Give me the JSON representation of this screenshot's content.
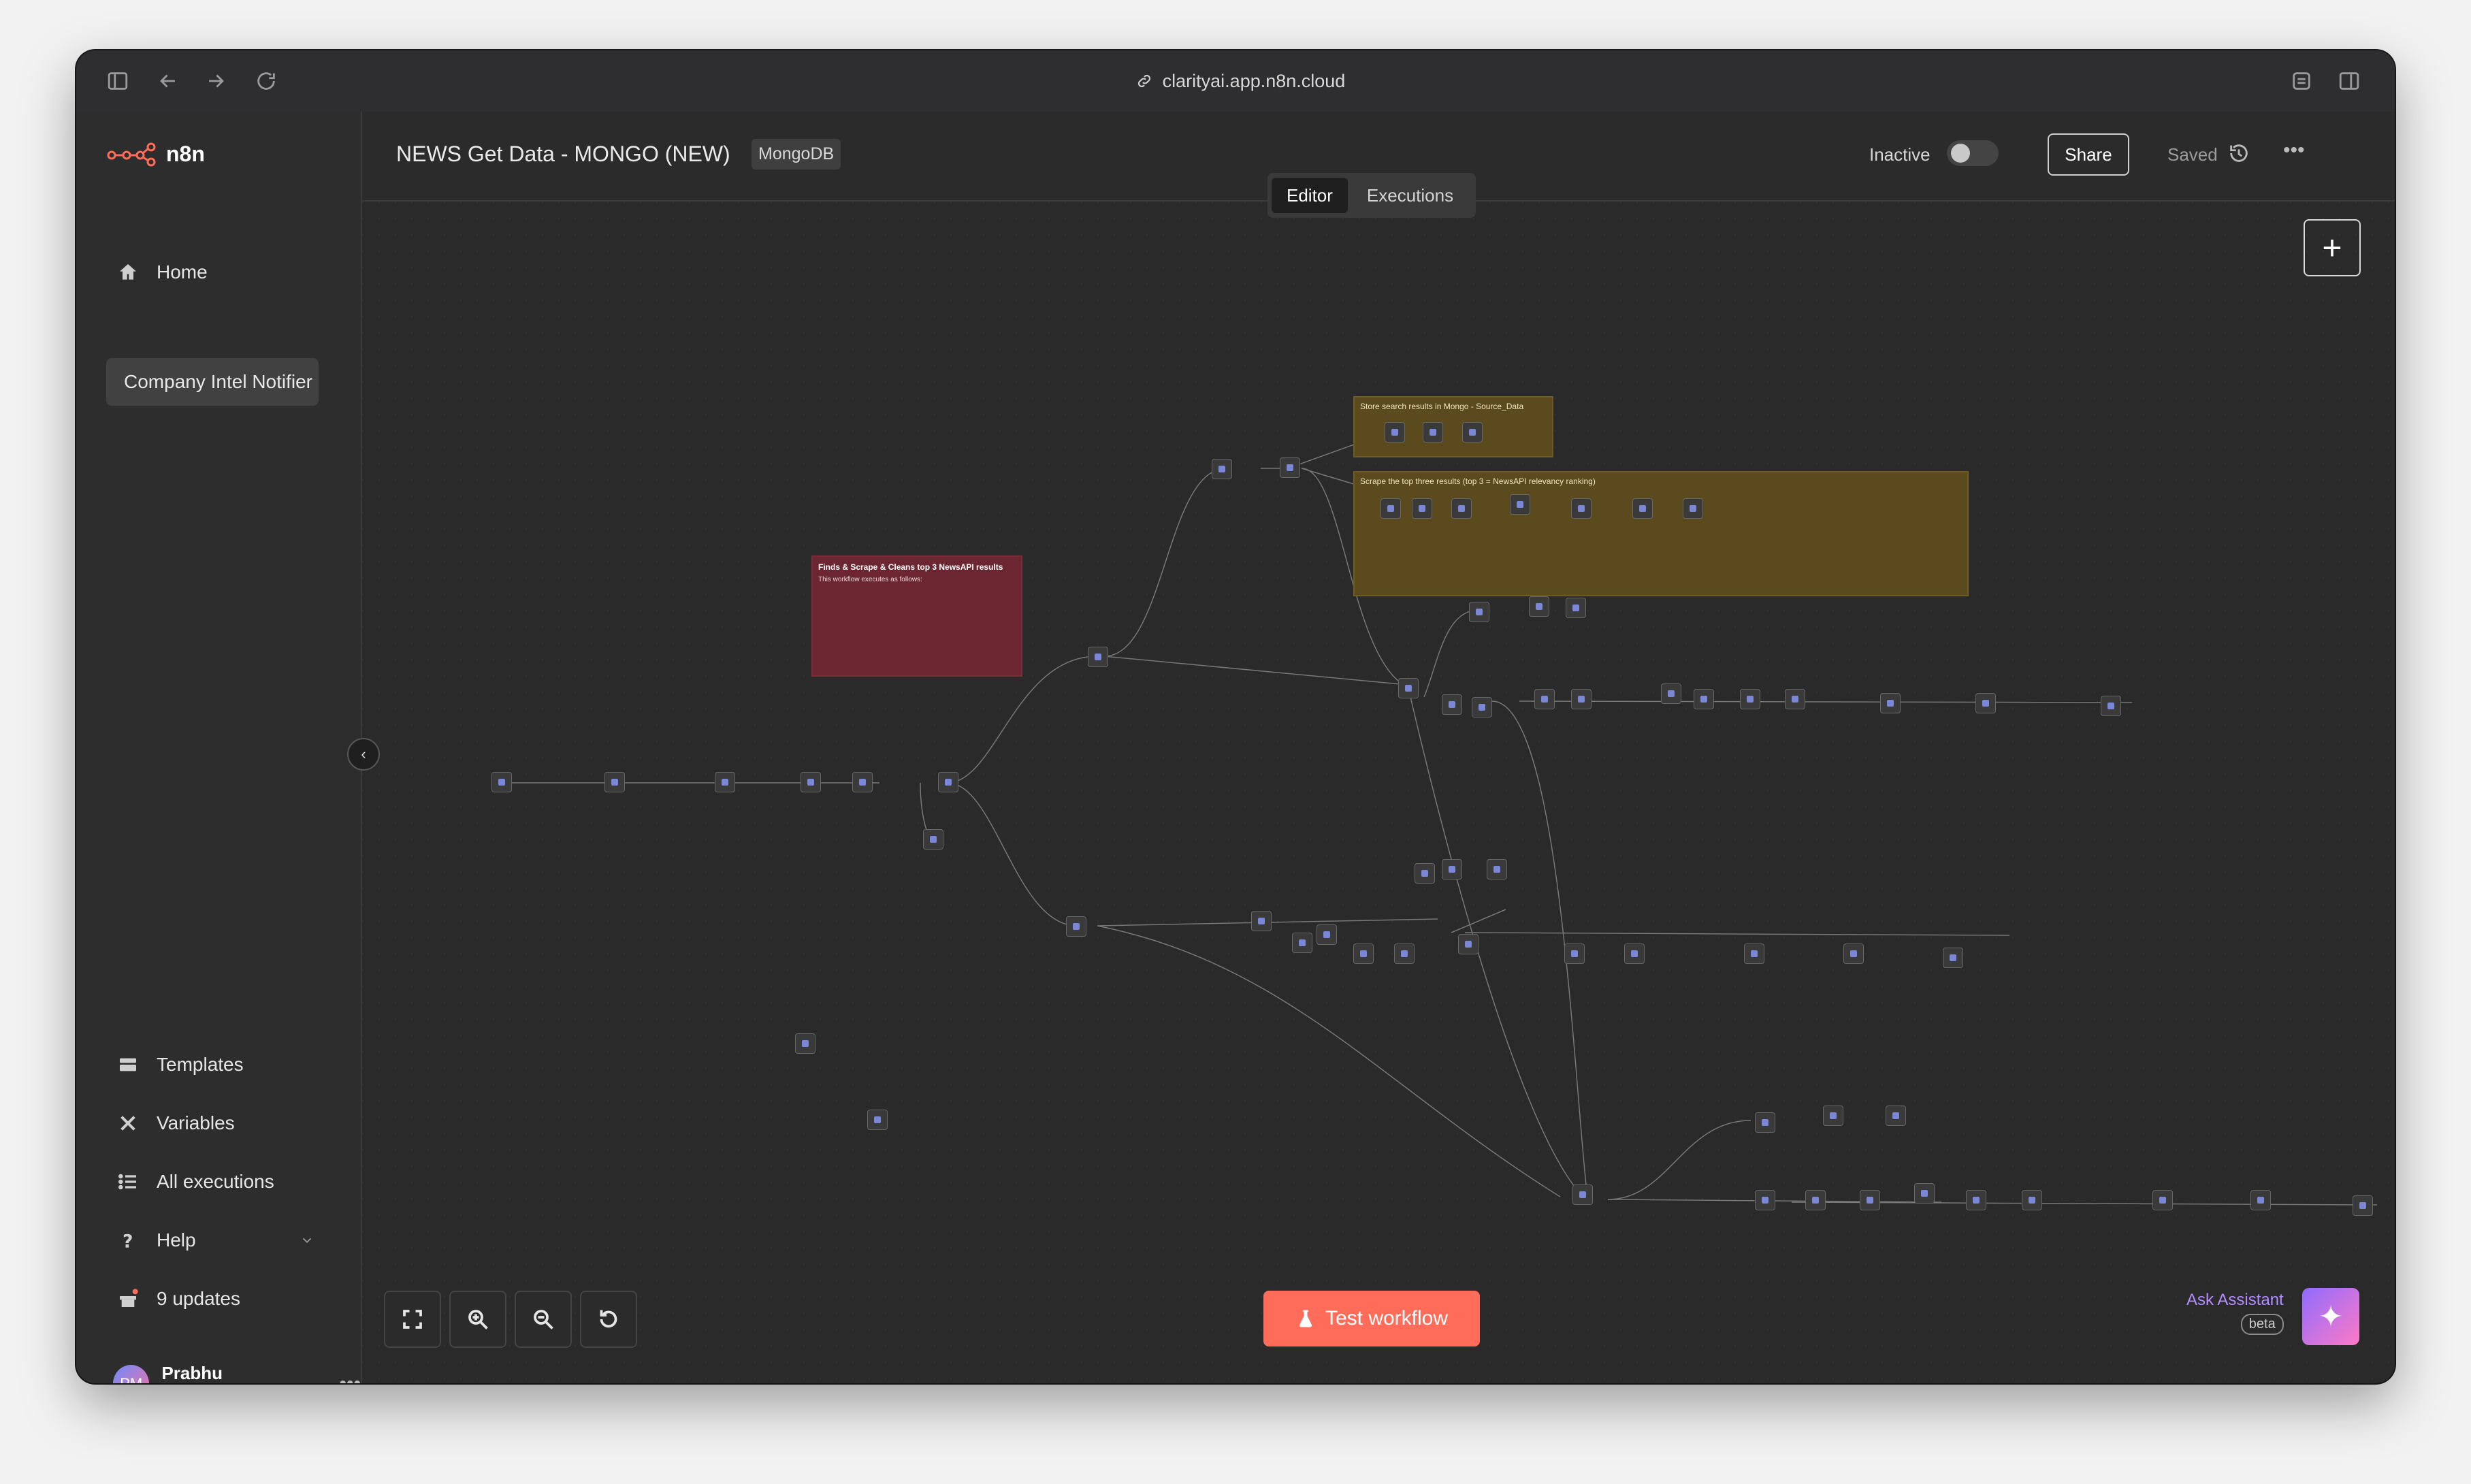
{
  "browser": {
    "url": "clarityai.app.n8n.cloud"
  },
  "sidebar": {
    "logo_text": "n8n",
    "home_label": "Home",
    "project_label": "Company Intel Notifier",
    "bottom_items": [
      {
        "label": "Templates",
        "icon": "templates-icon"
      },
      {
        "label": "Variables",
        "icon": "variables-icon"
      },
      {
        "label": "All executions",
        "icon": "executions-icon"
      },
      {
        "label": "Help",
        "icon": "help-icon"
      },
      {
        "label": "9 updates",
        "icon": "gift-icon"
      }
    ],
    "user": {
      "initials": "PM",
      "name": "Prabhu M"
    }
  },
  "header": {
    "workflow_title": "NEWS Get Data - MONGO (NEW)",
    "tag": "MongoDB",
    "inactive_label": "Inactive",
    "share_label": "Share",
    "saved_label": "Saved"
  },
  "tabs": [
    "Editor",
    "Executions"
  ],
  "canvas": {
    "sticky_red": {
      "title": "Finds & Scrape & Cleans top 3 NewsAPI results",
      "intro": "This workflow executes as follows:"
    },
    "sticky_mongo": "Store search results in Mongo - Source_Data",
    "sticky_scrape": "Scrape the top three results (top 3 = NewsAPI relevancy ranking)"
  },
  "footer": {
    "test_label": "Test workflow",
    "ask_label": "Ask Assistant",
    "beta_label": "beta"
  },
  "colors": {
    "accent": "#ff6d5a",
    "canvas_bg": "#2a2a2a",
    "sticky_red": "#6b2631",
    "sticky_yellow": "#5a4a1e",
    "assistant_gradient_start": "#8f6bff"
  }
}
